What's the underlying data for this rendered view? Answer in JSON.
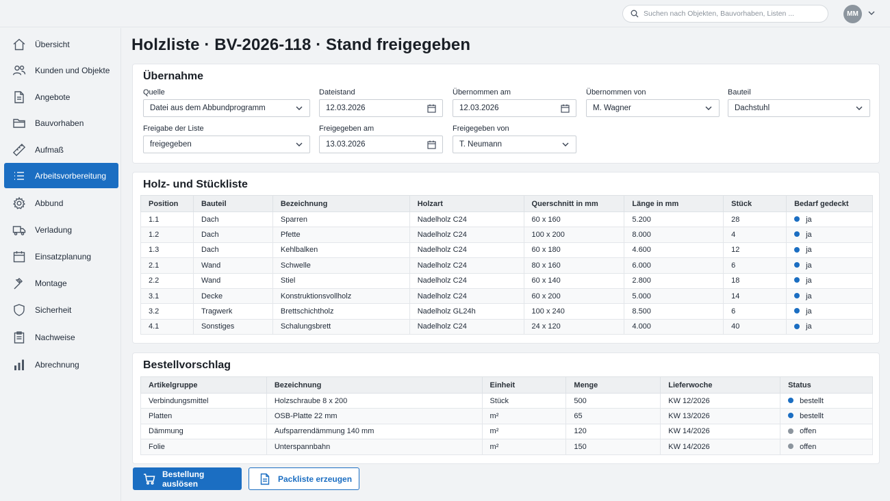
{
  "header": {
    "search_placeholder": "Suchen nach Objekten, Bauvorhaben, Listen ...",
    "user_initials": "MM"
  },
  "sidebar": {
    "items": [
      {
        "label": "Übersicht",
        "icon": "home-icon"
      },
      {
        "label": "Kunden und Objekte",
        "icon": "users-icon"
      },
      {
        "label": "Angebote",
        "icon": "document-icon"
      },
      {
        "label": "Bauvorhaben",
        "icon": "folder-icon"
      },
      {
        "label": "Aufmaß",
        "icon": "ruler-icon"
      },
      {
        "label": "Arbeitsvorbereitung",
        "icon": "list-icon",
        "active": true
      },
      {
        "label": "Abbund",
        "icon": "gear-icon"
      },
      {
        "label": "Verladung",
        "icon": "truck-icon"
      },
      {
        "label": "Einsatzplanung",
        "icon": "calendar-icon"
      },
      {
        "label": "Montage",
        "icon": "hammer-icon"
      },
      {
        "label": "Sicherheit",
        "icon": "shield-icon"
      },
      {
        "label": "Nachweise",
        "icon": "clipboard-icon"
      },
      {
        "label": "Abrechnung",
        "icon": "bar-chart-icon"
      }
    ]
  },
  "page": {
    "title": "Holzliste · BV-2026-118 · Stand freigegeben"
  },
  "uebernahme": {
    "title": "Übernahme",
    "quelle": {
      "label": "Quelle",
      "value": "Datei aus dem Abbundprogramm"
    },
    "dateistand": {
      "label": "Dateistand",
      "value": "12.03.2026"
    },
    "uebernommen_am": {
      "label": "Übernommen am",
      "value": "12.03.2026"
    },
    "uebernommen_von": {
      "label": "Übernommen von",
      "value": "M. Wagner"
    },
    "bauteil": {
      "label": "Bauteil",
      "value": "Dachstuhl"
    },
    "freigabe": {
      "label": "Freigabe der Liste",
      "value": "freigegeben"
    },
    "freigegeben_am": {
      "label": "Freigegeben am",
      "value": "13.03.2026"
    },
    "freigegeben_von": {
      "label": "Freigegeben von",
      "value": "T. Neumann"
    }
  },
  "holzliste": {
    "title": "Holz- und Stückliste",
    "columns": [
      "Position",
      "Bauteil",
      "Bezeichnung",
      "Holzart",
      "Querschnitt in mm",
      "Länge in mm",
      "Stück",
      "Bedarf gedeckt"
    ],
    "rows": [
      [
        "1.1",
        "Dach",
        "Sparren",
        "Nadelholz C24",
        "60 x 160",
        "5.200",
        "28",
        "ja"
      ],
      [
        "1.2",
        "Dach",
        "Pfette",
        "Nadelholz C24",
        "100 x 200",
        "8.000",
        "4",
        "ja"
      ],
      [
        "1.3",
        "Dach",
        "Kehlbalken",
        "Nadelholz C24",
        "60 x 180",
        "4.600",
        "12",
        "ja"
      ],
      [
        "2.1",
        "Wand",
        "Schwelle",
        "Nadelholz C24",
        "80 x 160",
        "6.000",
        "6",
        "ja"
      ],
      [
        "2.2",
        "Wand",
        "Stiel",
        "Nadelholz C24",
        "60 x 140",
        "2.800",
        "18",
        "ja"
      ],
      [
        "3.1",
        "Decke",
        "Konstruktionsvollholz",
        "Nadelholz C24",
        "60 x 200",
        "5.000",
        "14",
        "ja"
      ],
      [
        "3.2",
        "Tragwerk",
        "Brettschichtholz",
        "Nadelholz GL24h",
        "100 x 240",
        "8.500",
        "6",
        "ja"
      ],
      [
        "4.1",
        "Sonstiges",
        "Schalungsbrett",
        "Nadelholz C24",
        "24 x 120",
        "4.000",
        "40",
        "ja"
      ]
    ]
  },
  "bestellung": {
    "title": "Bestellvorschlag",
    "columns": [
      "Artikelgruppe",
      "Bezeichnung",
      "Einheit",
      "Menge",
      "Lieferwoche",
      "Status"
    ],
    "rows": [
      [
        "Verbindungsmittel",
        "Holzschraube 8 x 200",
        "Stück",
        "500",
        "KW 12/2026",
        "bestellt"
      ],
      [
        "Platten",
        "OSB-Platte 22 mm",
        "m²",
        "65",
        "KW 13/2026",
        "bestellt"
      ],
      [
        "Dämmung",
        "Aufsparrendämmung 140 mm",
        "m²",
        "120",
        "KW 14/2026",
        "offen"
      ],
      [
        "Folie",
        "Unterspannbahn",
        "m²",
        "150",
        "KW 14/2026",
        "offen"
      ]
    ]
  },
  "actions": {
    "order_label": "Bestellung auslösen",
    "packlist_label": "Packliste erzeugen"
  },
  "colors": {
    "accent": "#1b6ec2",
    "status_ok": "#1b6ec2",
    "status_open": "#8c959e"
  }
}
